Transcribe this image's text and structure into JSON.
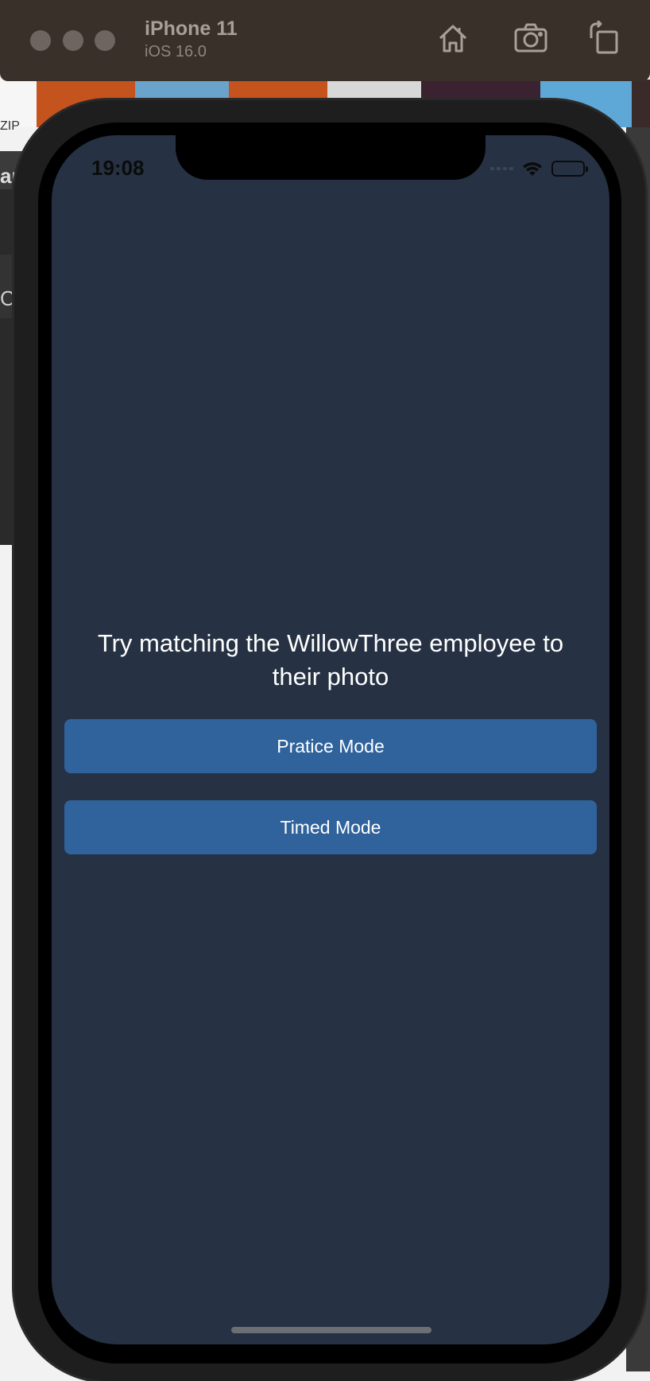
{
  "simulator": {
    "device_name": "iPhone 11",
    "os_version": "iOS 16.0",
    "toolbar_icons": [
      "home-icon",
      "screenshot-icon",
      "rotate-icon"
    ]
  },
  "background": {
    "zip_label": "ZIP",
    "partial_text_top": "ar",
    "partial_text_mid": "C"
  },
  "status_bar": {
    "time": "19:08",
    "icons": [
      "cellular-signal-icon",
      "wifi-icon",
      "battery-icon"
    ]
  },
  "main": {
    "headline": "Try matching the WillowThree employee to their photo",
    "buttons": {
      "practice": "Pratice Mode",
      "timed": "Timed Mode"
    }
  },
  "colors": {
    "screen_background": "#263244",
    "button_background": "#30639c",
    "text": "#ffffff",
    "titlebar": "#3a302a"
  }
}
